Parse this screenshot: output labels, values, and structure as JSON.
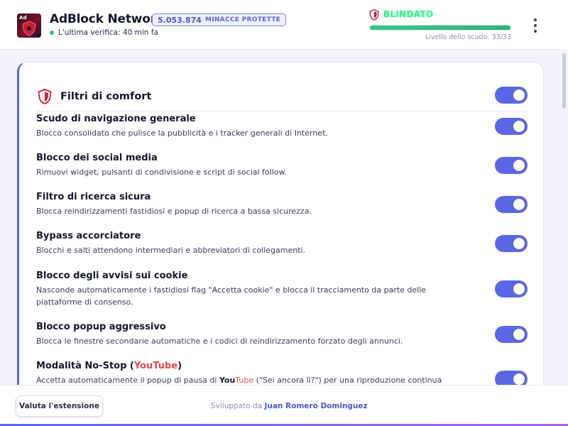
{
  "header": {
    "logo_text": "Ad",
    "app_title": "AdBlock Network",
    "threat_count": "5.053.874",
    "threat_label": "MINACCE PROTETTE",
    "last_check": "L'ultima verifica: 40 min fa",
    "shield_status": "BLINDATO",
    "shield_level_text": "Livello dello scudo: 33/33",
    "shield_level_fraction": 1.0
  },
  "card": {
    "title": "Filtri di comfort",
    "main_toggle_on": true,
    "settings": [
      {
        "title": "Scudo di navigazione generale",
        "desc": "Blocco consolidato che pulisce la pubblicità e i tracker generali di Internet.",
        "on": true
      },
      {
        "title": "Blocco dei social media",
        "desc": "Rimuovi widget, pulsanti di condivisione e script di social follow.",
        "on": true
      },
      {
        "title": "Filtro di ricerca sicura",
        "desc": "Blocca reindirizzamenti fastidiosi e popup di ricerca a bassa sicurezza.",
        "on": true
      },
      {
        "title": "Bypass accorciatore",
        "desc": "Blocchi e salti attendono intermediari e abbreviatori di collegamenti.",
        "on": true
      },
      {
        "title": "Blocco degli avvisi sui cookie",
        "desc": "Nasconde automaticamente i fastidiosi flag \"Accetta cookie\" e blocca il tracciamento da parte delle piattaforme di consenso.",
        "on": true
      },
      {
        "title": "Blocco popup aggressivo",
        "desc": "Blocca le finestre secondarie automatiche e i codici di reindirizzamento forzato degli annunci.",
        "on": true
      },
      {
        "title_prefix": "Modalità No-Stop (",
        "title_you": "You",
        "title_tube": "Tube",
        "title_suffix": ")",
        "desc_prefix": "Accetta automaticamente il popup di pausa di ",
        "desc_you": "You",
        "desc_tube": "Tube",
        "desc_suffix": " (\"Sei ancora lì?\") per una riproduzione continua e",
        "on": true
      }
    ]
  },
  "footer": {
    "rate_button": "Valuta l'estensione",
    "dev_prefix": "Sviluppato da ",
    "dev_name": "Juan Romero Dominguez"
  },
  "colors": {
    "accent": "#5b67e6",
    "status_green": "#36ef8a",
    "youtube_red": "#e04a4a"
  },
  "icons": [
    "shield-icon",
    "more-vertical-icon",
    "status-dot-icon"
  ]
}
